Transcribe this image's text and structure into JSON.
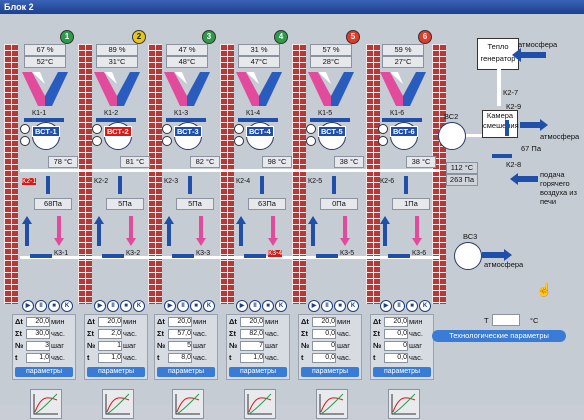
{
  "window": {
    "title": "Блок 2"
  },
  "columns": [
    {
      "num": "1",
      "num_color": "#2f9a4a",
      "pct": "67 %",
      "temp_top": "52°C",
      "k_label": "К1-1",
      "vct": "ВСТ-1",
      "vct_red": false,
      "temp_mid": "78 °C",
      "k2_label": "К2-1",
      "k2_red": true,
      "pa": "68Па",
      "k3_label": "К3-1",
      "k3_red": false
    },
    {
      "num": "2",
      "num_color": "#e6c619",
      "pct": "89 %",
      "temp_top": "31°C",
      "k_label": "К1-2",
      "vct": "ВСТ-2",
      "vct_red": true,
      "temp_mid": "81 °C",
      "k2_label": "К2-2",
      "k2_red": false,
      "pa": "5Па",
      "k3_label": "К3-2",
      "k3_red": false
    },
    {
      "num": "3",
      "num_color": "#2f9a4a",
      "pct": "47 %",
      "temp_top": "48°C",
      "k_label": "К1-3",
      "vct": "ВСТ-3",
      "vct_red": false,
      "temp_mid": "82 °C",
      "k2_label": "К2-3",
      "k2_red": false,
      "pa": "5Па",
      "k3_label": "К3-3",
      "k3_red": false
    },
    {
      "num": "4",
      "num_color": "#2f9a4a",
      "pct": "31 %",
      "temp_top": "47°C",
      "k_label": "К1-4",
      "vct": "ВСТ-4",
      "vct_red": false,
      "temp_mid": "98 °C",
      "k2_label": "К2-4",
      "k2_red": false,
      "pa": "63Па",
      "k3_label": "К3-4",
      "k3_red": true
    },
    {
      "num": "5",
      "num_color": "#e03a2a",
      "pct": "57 %",
      "temp_top": "28°C",
      "k_label": "К1-5",
      "vct": "ВСТ-5",
      "vct_red": false,
      "temp_mid": "38 °C",
      "k2_label": "К2-5",
      "k2_red": false,
      "pa": "0Па",
      "k3_label": "К3-5",
      "k3_red": false
    },
    {
      "num": "6",
      "num_color": "#e03a2a",
      "pct": "59 %",
      "temp_top": "27°C",
      "k_label": "К1-6",
      "vct": "ВСТ-6",
      "vct_red": false,
      "temp_mid": "38 °C",
      "k2_label": "К2-6",
      "k2_red": false,
      "pa": "1Па",
      "k3_label": "К3-6",
      "k3_red": false
    }
  ],
  "panels": [
    {
      "dt": "20,0",
      "dt_unit": "мин",
      "sum": "30,0",
      "sum_unit": "час.",
      "n": "3",
      "n_unit": "шаг",
      "t": "1,0",
      "t_unit": "час.",
      "btn": "параметры"
    },
    {
      "dt": "20,0",
      "dt_unit": "мин",
      "sum": "2,0",
      "sum_unit": "час.",
      "n": "1",
      "n_unit": "шаг",
      "t": "1,0",
      "t_unit": "час.",
      "btn": "параметры"
    },
    {
      "dt": "20,0",
      "dt_unit": "мин",
      "sum": "57,0",
      "sum_unit": "час.",
      "n": "5",
      "n_unit": "шаг",
      "t": "8,0",
      "t_unit": "час.",
      "btn": "параметры"
    },
    {
      "dt": "20,0",
      "dt_unit": "мин",
      "sum": "82,0",
      "sum_unit": "час.",
      "n": "7",
      "n_unit": "шаг",
      "t": "1,0",
      "t_unit": "час.",
      "btn": "параметры"
    },
    {
      "dt": "20,0",
      "dt_unit": "мин",
      "sum": "0,0",
      "sum_unit": "час.",
      "n": "0",
      "n_unit": "шаг",
      "t": "0,0",
      "t_unit": "час.",
      "btn": "параметры"
    },
    {
      "dt": "20,0",
      "dt_unit": "мин",
      "sum": "0,0",
      "sum_unit": "час.",
      "n": "0",
      "n_unit": "шаг",
      "t": "0,0",
      "t_unit": "час.",
      "btn": "параметры"
    }
  ],
  "panel_labels": {
    "dt": "Δt",
    "sum": "Σt",
    "n": "№",
    "t": "t"
  },
  "ctrl_icons": [
    "▶",
    "II",
    "■",
    "K"
  ],
  "right": {
    "heat_gen": "Тепло генератор",
    "atm1": "атмосфера",
    "k27": "К2-7",
    "k29": "К2-9",
    "atm2": "атмосфера",
    "mixer": "Камера смешения",
    "pa67": "67 Па",
    "k28": "К2-8",
    "supply": "подача горячего воздуха из печи",
    "vc2": "ВС2",
    "temp112": "112 °C",
    "pa263": "263 Па",
    "vc3": "ВС3",
    "atm3": "атмосфера",
    "t_label": "T",
    "t_unit": "°C",
    "tech_btn": "Технологические параметры"
  }
}
